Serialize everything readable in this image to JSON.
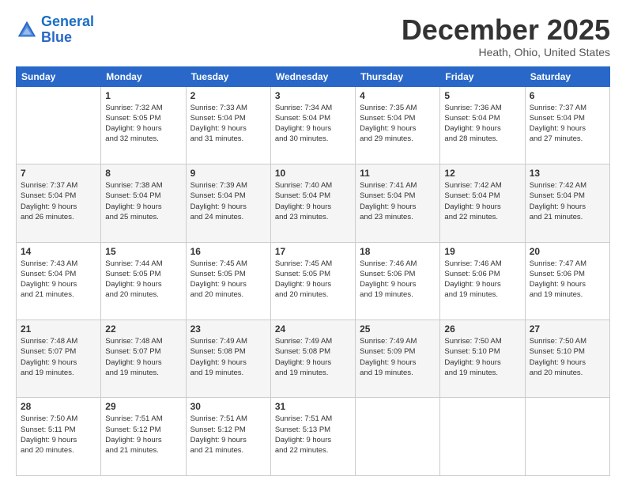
{
  "header": {
    "logo_line1": "General",
    "logo_line2": "Blue",
    "month": "December 2025",
    "location": "Heath, Ohio, United States"
  },
  "days_of_week": [
    "Sunday",
    "Monday",
    "Tuesday",
    "Wednesday",
    "Thursday",
    "Friday",
    "Saturday"
  ],
  "weeks": [
    [
      {
        "day": "",
        "info": ""
      },
      {
        "day": "1",
        "info": "Sunrise: 7:32 AM\nSunset: 5:05 PM\nDaylight: 9 hours\nand 32 minutes."
      },
      {
        "day": "2",
        "info": "Sunrise: 7:33 AM\nSunset: 5:04 PM\nDaylight: 9 hours\nand 31 minutes."
      },
      {
        "day": "3",
        "info": "Sunrise: 7:34 AM\nSunset: 5:04 PM\nDaylight: 9 hours\nand 30 minutes."
      },
      {
        "day": "4",
        "info": "Sunrise: 7:35 AM\nSunset: 5:04 PM\nDaylight: 9 hours\nand 29 minutes."
      },
      {
        "day": "5",
        "info": "Sunrise: 7:36 AM\nSunset: 5:04 PM\nDaylight: 9 hours\nand 28 minutes."
      },
      {
        "day": "6",
        "info": "Sunrise: 7:37 AM\nSunset: 5:04 PM\nDaylight: 9 hours\nand 27 minutes."
      }
    ],
    [
      {
        "day": "7",
        "info": "Sunrise: 7:37 AM\nSunset: 5:04 PM\nDaylight: 9 hours\nand 26 minutes."
      },
      {
        "day": "8",
        "info": "Sunrise: 7:38 AM\nSunset: 5:04 PM\nDaylight: 9 hours\nand 25 minutes."
      },
      {
        "day": "9",
        "info": "Sunrise: 7:39 AM\nSunset: 5:04 PM\nDaylight: 9 hours\nand 24 minutes."
      },
      {
        "day": "10",
        "info": "Sunrise: 7:40 AM\nSunset: 5:04 PM\nDaylight: 9 hours\nand 23 minutes."
      },
      {
        "day": "11",
        "info": "Sunrise: 7:41 AM\nSunset: 5:04 PM\nDaylight: 9 hours\nand 23 minutes."
      },
      {
        "day": "12",
        "info": "Sunrise: 7:42 AM\nSunset: 5:04 PM\nDaylight: 9 hours\nand 22 minutes."
      },
      {
        "day": "13",
        "info": "Sunrise: 7:42 AM\nSunset: 5:04 PM\nDaylight: 9 hours\nand 21 minutes."
      }
    ],
    [
      {
        "day": "14",
        "info": "Sunrise: 7:43 AM\nSunset: 5:04 PM\nDaylight: 9 hours\nand 21 minutes."
      },
      {
        "day": "15",
        "info": "Sunrise: 7:44 AM\nSunset: 5:05 PM\nDaylight: 9 hours\nand 20 minutes."
      },
      {
        "day": "16",
        "info": "Sunrise: 7:45 AM\nSunset: 5:05 PM\nDaylight: 9 hours\nand 20 minutes."
      },
      {
        "day": "17",
        "info": "Sunrise: 7:45 AM\nSunset: 5:05 PM\nDaylight: 9 hours\nand 20 minutes."
      },
      {
        "day": "18",
        "info": "Sunrise: 7:46 AM\nSunset: 5:06 PM\nDaylight: 9 hours\nand 19 minutes."
      },
      {
        "day": "19",
        "info": "Sunrise: 7:46 AM\nSunset: 5:06 PM\nDaylight: 9 hours\nand 19 minutes."
      },
      {
        "day": "20",
        "info": "Sunrise: 7:47 AM\nSunset: 5:06 PM\nDaylight: 9 hours\nand 19 minutes."
      }
    ],
    [
      {
        "day": "21",
        "info": "Sunrise: 7:48 AM\nSunset: 5:07 PM\nDaylight: 9 hours\nand 19 minutes."
      },
      {
        "day": "22",
        "info": "Sunrise: 7:48 AM\nSunset: 5:07 PM\nDaylight: 9 hours\nand 19 minutes."
      },
      {
        "day": "23",
        "info": "Sunrise: 7:49 AM\nSunset: 5:08 PM\nDaylight: 9 hours\nand 19 minutes."
      },
      {
        "day": "24",
        "info": "Sunrise: 7:49 AM\nSunset: 5:08 PM\nDaylight: 9 hours\nand 19 minutes."
      },
      {
        "day": "25",
        "info": "Sunrise: 7:49 AM\nSunset: 5:09 PM\nDaylight: 9 hours\nand 19 minutes."
      },
      {
        "day": "26",
        "info": "Sunrise: 7:50 AM\nSunset: 5:10 PM\nDaylight: 9 hours\nand 19 minutes."
      },
      {
        "day": "27",
        "info": "Sunrise: 7:50 AM\nSunset: 5:10 PM\nDaylight: 9 hours\nand 20 minutes."
      }
    ],
    [
      {
        "day": "28",
        "info": "Sunrise: 7:50 AM\nSunset: 5:11 PM\nDaylight: 9 hours\nand 20 minutes."
      },
      {
        "day": "29",
        "info": "Sunrise: 7:51 AM\nSunset: 5:12 PM\nDaylight: 9 hours\nand 21 minutes."
      },
      {
        "day": "30",
        "info": "Sunrise: 7:51 AM\nSunset: 5:12 PM\nDaylight: 9 hours\nand 21 minutes."
      },
      {
        "day": "31",
        "info": "Sunrise: 7:51 AM\nSunset: 5:13 PM\nDaylight: 9 hours\nand 22 minutes."
      },
      {
        "day": "",
        "info": ""
      },
      {
        "day": "",
        "info": ""
      },
      {
        "day": "",
        "info": ""
      }
    ]
  ]
}
